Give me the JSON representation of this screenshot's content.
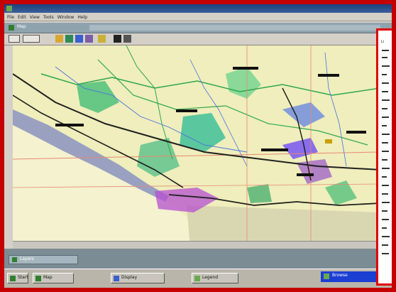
{
  "window": {
    "title": "",
    "colors": {
      "frame": "#c40000",
      "titlebar": "#1c3f7a",
      "map_bg": "#efeebc",
      "taskbar": "#b9b5aa",
      "tray": "#1b3fd3"
    }
  },
  "menu": {
    "items": [
      "File",
      "Edit",
      "View",
      "Tools",
      "Window",
      "Help"
    ]
  },
  "document_tab": {
    "label": "Map"
  },
  "toolbar": {
    "icons": [
      "pointer-icon",
      "zoom-icon",
      "layer-icon",
      "globe-icon",
      "grid-icon",
      "route-icon",
      "print-icon",
      "legend-icon"
    ]
  },
  "map": {
    "status_left": "",
    "status_right": ""
  },
  "side_panel": {
    "header": "Li"
  },
  "lower_tab": {
    "label": "Layers"
  },
  "taskbar": {
    "start_label": "Start",
    "buttons": [
      {
        "label": "Map",
        "icon": "map-icon"
      },
      {
        "label": "Display",
        "icon": "display-icon"
      },
      {
        "label": "Legend",
        "icon": "legend-icon"
      }
    ],
    "tray_label": "Browse"
  }
}
